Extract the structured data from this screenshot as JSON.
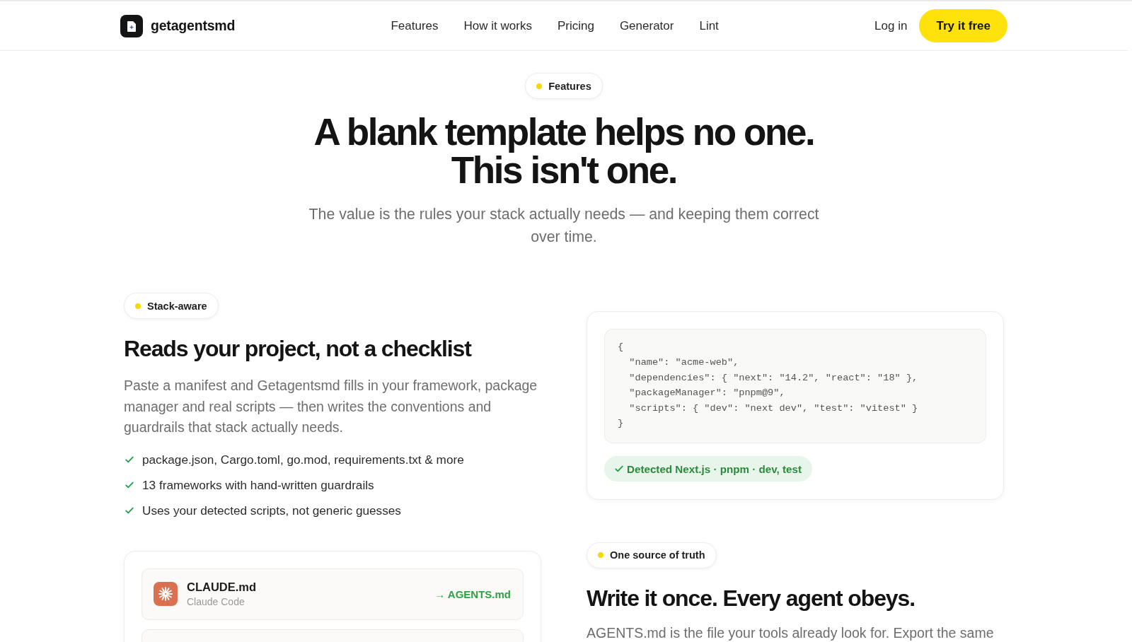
{
  "header": {
    "logo": {
      "text": "getagentsmd"
    },
    "nav": [
      {
        "label": "Features"
      },
      {
        "label": "How it works"
      },
      {
        "label": "Pricing"
      },
      {
        "label": "Generator"
      },
      {
        "label": "Lint"
      }
    ],
    "login": "Log in",
    "cta": "Try it free"
  },
  "hero": {
    "badge": "Features",
    "title": "A blank template helps no one. This isn't one.",
    "subtitle": "The value is the rules your stack actually needs — and keeping them correct over time."
  },
  "features": [
    {
      "kind": "text",
      "badge": "Stack-aware",
      "title": "Reads your project, not a checklist",
      "body": "Paste a manifest and Getagentsmd fills in your framework, package manager and real scripts — then writes the conventions and guardrails that stack actually needs.",
      "bullets": [
        "package.json, Cargo.toml, go.mod, requirements.txt & more",
        "13 frameworks with hand-written guardrails",
        "Uses your detected scripts, not generic guesses"
      ]
    },
    {
      "kind": "code",
      "code_lines": [
        "{",
        "  \"name\": \"acme-web\",",
        "  \"dependencies\": { \"next\": \"14.2\", \"react\": \"18\" },",
        "  \"packageManager\": \"pnpm@9\",",
        "  \"scripts\": { \"dev\": \"next dev\", \"test\": \"vitest\" }",
        "}"
      ],
      "detected": "Detected Next.js · pnpm · dev, test"
    },
    {
      "kind": "files",
      "files": [
        {
          "name": "CLAUDE.md",
          "tool": "Claude Code",
          "target": "→ AGENTS.md"
        }
      ]
    },
    {
      "kind": "text",
      "badge": "One source of truth",
      "title": "Write it once. Every agent obeys.",
      "body": "AGENTS.md is the file your tools already look for. Export the same"
    }
  ]
}
